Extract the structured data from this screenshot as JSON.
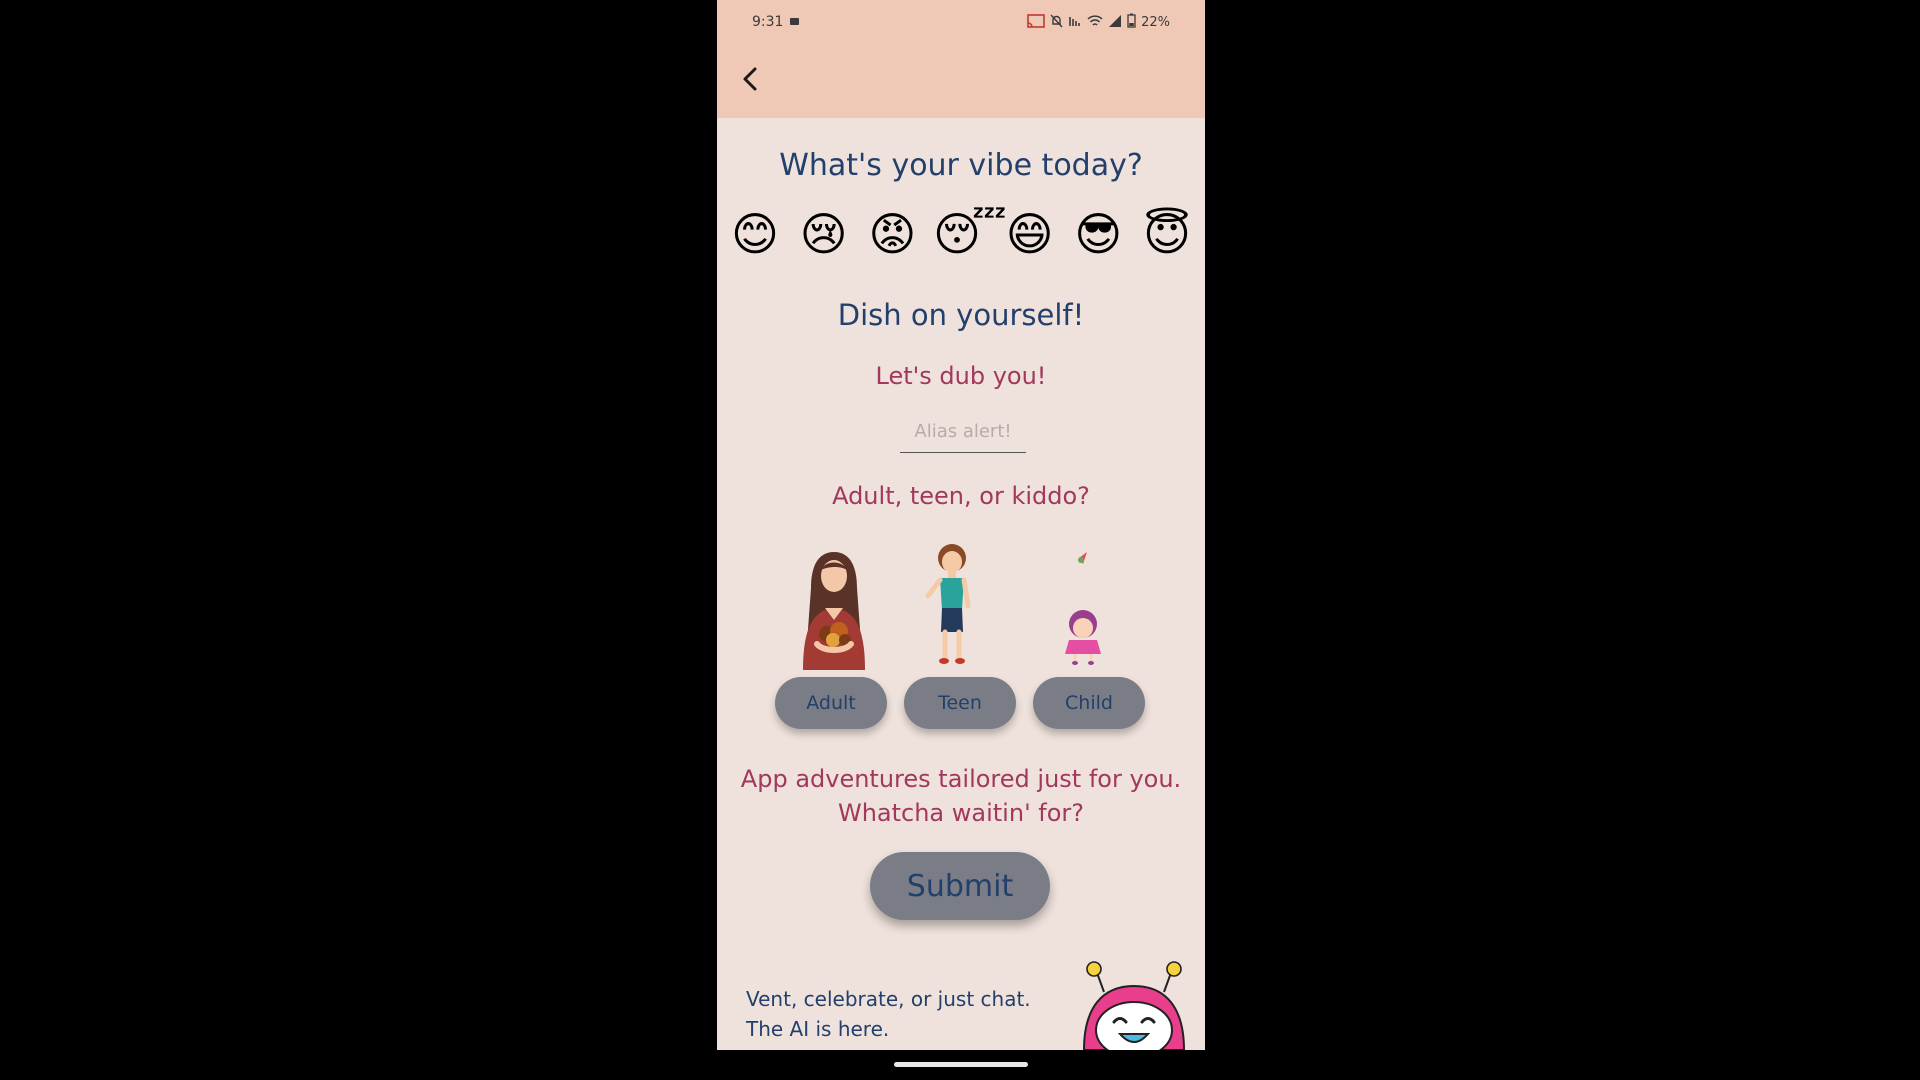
{
  "status_bar": {
    "time": "9:31",
    "battery": "22%"
  },
  "nav": {
    "back_icon": "chevron-left-icon"
  },
  "vibe": {
    "title": "What's your vibe today?",
    "emojis": [
      "😊",
      "😢",
      "😡",
      "😴",
      "😄",
      "😎",
      "😇"
    ]
  },
  "profile": {
    "title": "Dish on yourself!",
    "dub_label": "Let's dub you!",
    "alias_placeholder": "Alias alert!",
    "age_label": "Adult, teen, or kiddo?",
    "age_options": [
      "Adult",
      "Teen",
      "Child"
    ]
  },
  "cta": {
    "tailored_line1": "App adventures tailored just for you.",
    "tailored_line2": "Whatcha waitin' for?",
    "submit_label": "Submit"
  },
  "chat_promo": {
    "line1": "Vent, celebrate, or just chat.",
    "line2": "The AI is here."
  },
  "colors": {
    "header_bg": "#efc8b6",
    "page_bg": "#efe2dc",
    "navy_text": "#233f6b",
    "rose_text": "#a2385c",
    "button_gray": "#7a7d85",
    "bot_pink": "#e83e8c"
  }
}
